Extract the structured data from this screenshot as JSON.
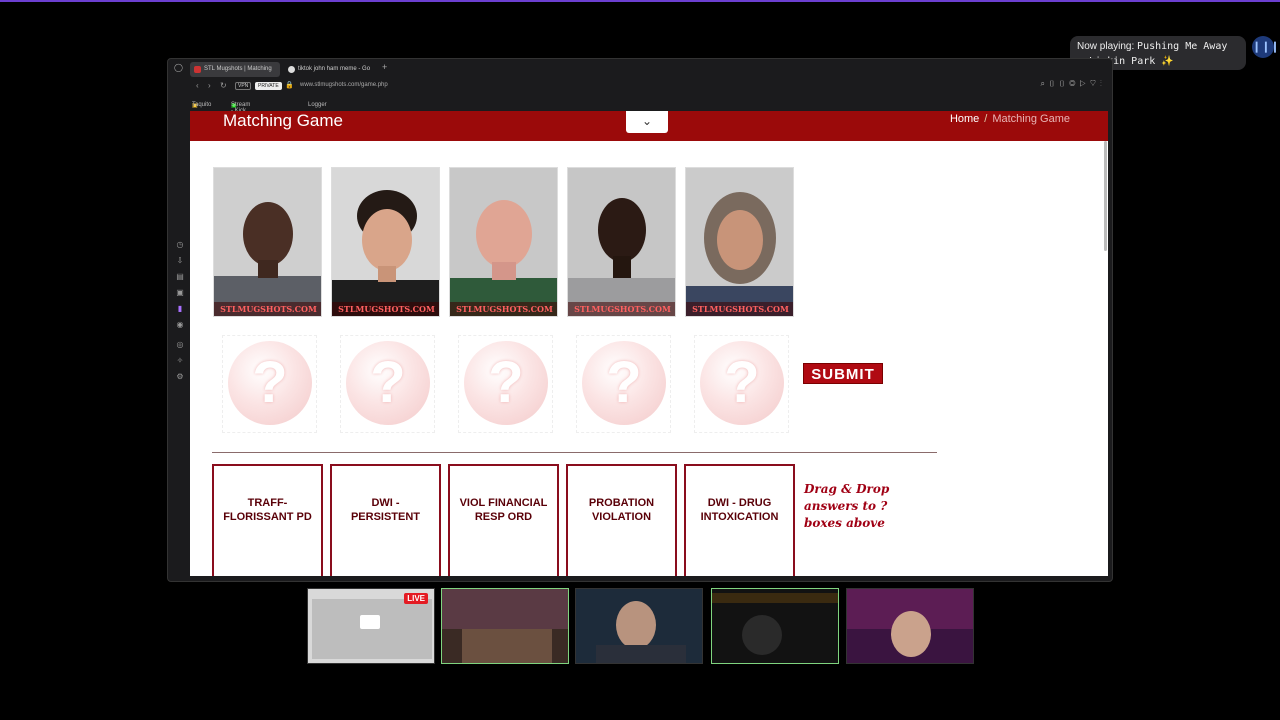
{
  "now_playing": {
    "label": "Now playing:",
    "song": "Pushing Me Away - Linkin Park ✨"
  },
  "browser": {
    "tabs": [
      {
        "title": "STL Mugshots | Matching",
        "active": true
      },
      {
        "title": "tiktok john ham meme - Go",
        "active": false
      }
    ],
    "address": {
      "vpn": "VPN",
      "private": "PRIVATE",
      "url": "www.stlmugshots.com/game.php"
    },
    "bookmarks": [
      "Taquito",
      "Stream - Kick Das...",
      "Logger"
    ]
  },
  "page": {
    "title": "Matching Game",
    "breadcrumb": {
      "home": "Home",
      "separator": "/",
      "current": "Matching Game"
    },
    "watermark": "STLMUGSHOTS.COM",
    "mugshots": [
      {
        "name": "mugshot-1"
      },
      {
        "name": "mugshot-2"
      },
      {
        "name": "mugshot-3"
      },
      {
        "name": "mugshot-4"
      },
      {
        "name": "mugshot-5"
      }
    ],
    "slot_glyph": "?",
    "submit_label": "SUBMIT",
    "answers": [
      "TRAFF-\nFLORISSANT PD",
      "DWI -\nPERSISTENT",
      "VIOL FINANCIAL\nRESP ORD",
      "PROBATION\nVIOLATION",
      "DWI - DRUG\nINTOXICATION"
    ],
    "hint": "Drag & Drop answers to ? boxes above"
  },
  "stream": {
    "live_badge": "LIVE"
  },
  "colors": {
    "banner": "#9b0a0a",
    "answer_border": "#8a0d1d",
    "submit": "#b00a12"
  }
}
